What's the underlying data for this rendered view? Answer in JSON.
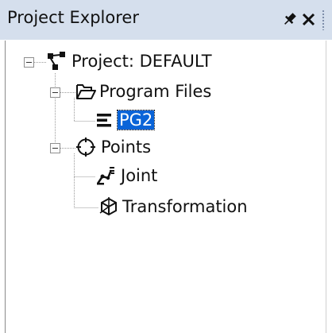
{
  "panel": {
    "title": "Project Explorer",
    "pin_icon": "pin-icon",
    "close_icon": "close-icon"
  },
  "tree": {
    "root": {
      "label": "Project: DEFAULT",
      "icon": "project-icon",
      "expanded": true,
      "children": [
        {
          "label": "Program Files",
          "icon": "folder-open-icon",
          "expanded": true,
          "children": [
            {
              "label": "PG2",
              "icon": "program-icon",
              "selected": true
            }
          ]
        },
        {
          "label": "Points",
          "icon": "crosshair-icon",
          "expanded": true,
          "children": [
            {
              "label": "Joint",
              "icon": "robot-joint-icon"
            },
            {
              "label": "Transformation",
              "icon": "cube-axes-icon"
            }
          ]
        }
      ]
    }
  },
  "colors": {
    "titlebar": "#d5dfed",
    "selection": "#0a64d8"
  }
}
